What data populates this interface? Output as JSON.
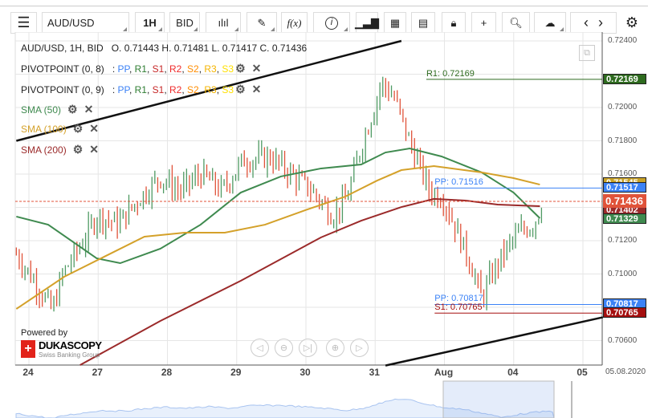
{
  "toolbar": {
    "symbol": "AUD/USD",
    "timeframe": "1H",
    "side": "BID",
    "fx_label": "f(x)"
  },
  "header": {
    "ohlc": "AUD/USD, 1H, BID   O. 0.71443 H. 0.71481 L. 0.71417 C. 0.71436"
  },
  "indicators": [
    {
      "name": "PIVOTPOINT (0, 8)",
      "levels": [
        "PP",
        "R1",
        "S1",
        "R2",
        "S2",
        "R3",
        "S3"
      ]
    },
    {
      "name": "PIVOTPOINT (0, 9)",
      "levels": [
        "PP",
        "R1",
        "S1",
        "R2",
        "S2",
        "R3",
        "S3"
      ]
    },
    {
      "name": "SMA (50)",
      "color": "#3f8a4f"
    },
    {
      "name": "SMA (100)",
      "color": "#d4a12a"
    },
    {
      "name": "SMA (200)",
      "color": "#9b2a2a"
    }
  ],
  "level_colors": [
    "#3b82f6",
    "#2e7d32",
    "#c62828",
    "#ef2b2b",
    "#ff8c00",
    "#f5b400",
    "#ffe000"
  ],
  "brand": {
    "powered": "Powered by",
    "name": "DUKASCOPY",
    "tagline": "Swiss Banking Group"
  },
  "price_axis": [
    "0.72400",
    "0.72000",
    "0.71800",
    "0.71600",
    "0.71200",
    "0.71000",
    "0.70600"
  ],
  "price_axis_values": [
    0.724,
    0.72,
    0.718,
    0.716,
    0.712,
    0.71,
    0.706
  ],
  "dates": [
    "24",
    "27",
    "28",
    "29",
    "30",
    "31",
    "Aug",
    "04",
    "05"
  ],
  "current_date": "05.08.2020",
  "levels": {
    "r1": "R1: 0.72169",
    "pp1": "PP: 0.71516",
    "pp2": "PP: 0.70817",
    "s1": "S1: 0.70765"
  },
  "badges": [
    {
      "text": "0.72169",
      "value": 0.72169,
      "color": "#2e6b1f"
    },
    {
      "text": "0.71545",
      "value": 0.71545,
      "color": "#c9a227"
    },
    {
      "text": "0.71517",
      "value": 0.71517,
      "color": "#3b82f6"
    },
    {
      "text": "0.71402",
      "value": 0.71402,
      "color": "#9b2a2a"
    },
    {
      "text": "0.71436",
      "value": 0.71436,
      "color": "#e0533a"
    },
    {
      "text": "0.71329",
      "value": 0.71329,
      "color": "#3f8a4f"
    },
    {
      "text": "0.70817",
      "value": 0.70817,
      "color": "#3b82f6"
    },
    {
      "text": "0.70765",
      "value": 0.70765,
      "color": "#a50f0f"
    }
  ],
  "chart_data": {
    "type": "ohlc",
    "ylim": [
      0.7035,
      0.725
    ],
    "price_path": [
      [
        -0.17,
        0.7112
      ],
      [
        0.1,
        0.7095
      ],
      [
        0.35,
        0.7078
      ],
      [
        0.5,
        0.71
      ],
      [
        0.8,
        0.712
      ],
      [
        1.0,
        0.7135
      ],
      [
        1.3,
        0.713
      ],
      [
        1.6,
        0.7145
      ],
      [
        1.9,
        0.7158
      ],
      [
        2.2,
        0.715
      ],
      [
        2.5,
        0.716
      ],
      [
        2.8,
        0.715
      ],
      [
        3.1,
        0.7168
      ],
      [
        3.5,
        0.717
      ],
      [
        3.8,
        0.716
      ],
      [
        4.1,
        0.715
      ],
      [
        4.4,
        0.7135
      ],
      [
        4.6,
        0.7145
      ],
      [
        4.8,
        0.7175
      ],
      [
        5.0,
        0.72
      ],
      [
        5.1,
        0.7215
      ],
      [
        5.3,
        0.7205
      ],
      [
        5.5,
        0.718
      ],
      [
        5.8,
        0.715
      ],
      [
        6.0,
        0.7145
      ],
      [
        6.2,
        0.7125
      ],
      [
        6.4,
        0.7105
      ],
      [
        6.55,
        0.7085
      ],
      [
        6.7,
        0.71
      ],
      [
        6.9,
        0.7115
      ],
      [
        7.1,
        0.7125
      ],
      [
        7.3,
        0.713
      ],
      [
        7.45,
        0.7144
      ]
    ],
    "sma50": [
      [
        -0.17,
        0.71345
      ],
      [
        0.29,
        0.71296
      ],
      [
        0.99,
        0.71094
      ],
      [
        1.33,
        0.71065
      ],
      [
        1.91,
        0.71152
      ],
      [
        2.49,
        0.71296
      ],
      [
        3.07,
        0.71489
      ],
      [
        3.65,
        0.71586
      ],
      [
        4.23,
        0.71634
      ],
      [
        4.81,
        0.71658
      ],
      [
        5.16,
        0.7173
      ],
      [
        5.51,
        0.71754
      ],
      [
        5.97,
        0.71706
      ],
      [
        6.55,
        0.7161
      ],
      [
        7.01,
        0.71489
      ],
      [
        7.39,
        0.71335
      ]
    ],
    "sma100": [
      [
        -0.17,
        0.7079
      ],
      [
        0.52,
        0.70983
      ],
      [
        1.1,
        0.71104
      ],
      [
        1.68,
        0.71224
      ],
      [
        2.26,
        0.71248
      ],
      [
        2.84,
        0.71248
      ],
      [
        3.42,
        0.71296
      ],
      [
        4.0,
        0.71383
      ],
      [
        4.58,
        0.71465
      ],
      [
        5.04,
        0.71561
      ],
      [
        5.39,
        0.71624
      ],
      [
        5.86,
        0.71648
      ],
      [
        6.55,
        0.7161
      ],
      [
        7.01,
        0.71576
      ],
      [
        7.39,
        0.71537
      ]
    ],
    "sma200": [
      [
        0.75,
        0.70453
      ],
      [
        1.91,
        0.70718
      ],
      [
        3.07,
        0.70959
      ],
      [
        4.23,
        0.7122
      ],
      [
        4.81,
        0.7132
      ],
      [
        5.39,
        0.71402
      ],
      [
        5.86,
        0.71451
      ],
      [
        6.32,
        0.71441
      ],
      [
        6.78,
        0.71417
      ],
      [
        7.39,
        0.71407
      ]
    ],
    "trendlines": [
      [
        [
          -0.17,
          0.718
        ],
        [
          5.39,
          0.724
        ]
      ],
      [
        [
          5.16,
          0.7045
        ],
        [
          8.3,
          0.7074
        ]
      ]
    ],
    "current": 0.71436,
    "pivots": [
      {
        "from": 5.75,
        "value": 0.72169,
        "color": "#2e6b1f"
      },
      {
        "from": 5.87,
        "value": 0.71516,
        "color": "#3b82f6"
      },
      {
        "from": 5.87,
        "value": 0.70817,
        "color": "#3b82f6"
      },
      {
        "from": 5.87,
        "value": 0.70765,
        "color": "#a50f0f"
      }
    ]
  }
}
